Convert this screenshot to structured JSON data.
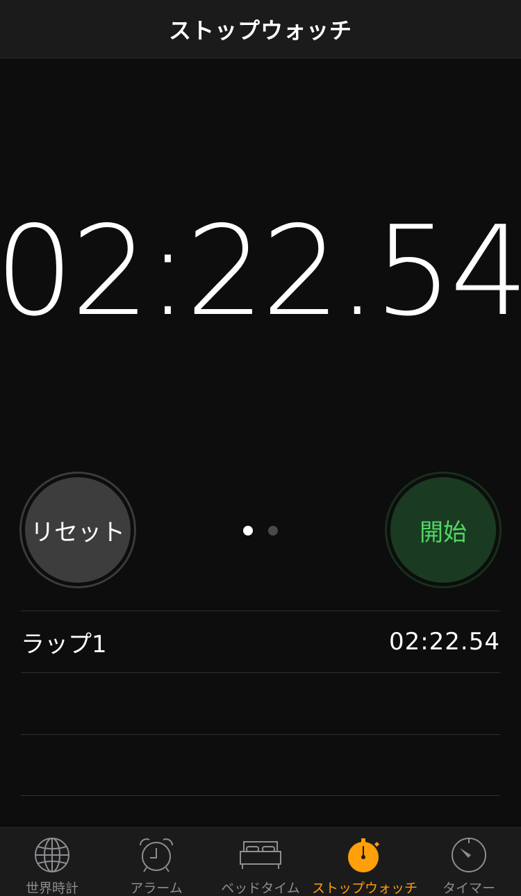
{
  "navbar": {
    "title": "ストップウォッチ"
  },
  "stopwatch": {
    "time": "02:22.54"
  },
  "controls": {
    "reset_label": "リセット",
    "start_label": "開始",
    "page_dots": 2,
    "active_page": 1
  },
  "laps": [
    {
      "label": "ラップ1",
      "time": "02:22.54"
    },
    {
      "label": "",
      "time": ""
    },
    {
      "label": "",
      "time": ""
    }
  ],
  "tabbar": {
    "tabs": [
      {
        "label": "世界時計",
        "icon": "globe-icon",
        "active": false
      },
      {
        "label": "アラーム",
        "icon": "alarm-clock-icon",
        "active": false
      },
      {
        "label": "ベッドタイム",
        "icon": "bed-icon",
        "active": false
      },
      {
        "label": "ストップウォッチ",
        "icon": "stopwatch-icon",
        "active": true
      },
      {
        "label": "タイマー",
        "icon": "timer-icon",
        "active": false
      }
    ]
  },
  "colors": {
    "accent": "#ff9f0a",
    "start_text": "#4fd964",
    "start_bg": "#1b3a22",
    "reset_bg": "#3d3d3d",
    "tab_inactive": "#8e8e93"
  }
}
